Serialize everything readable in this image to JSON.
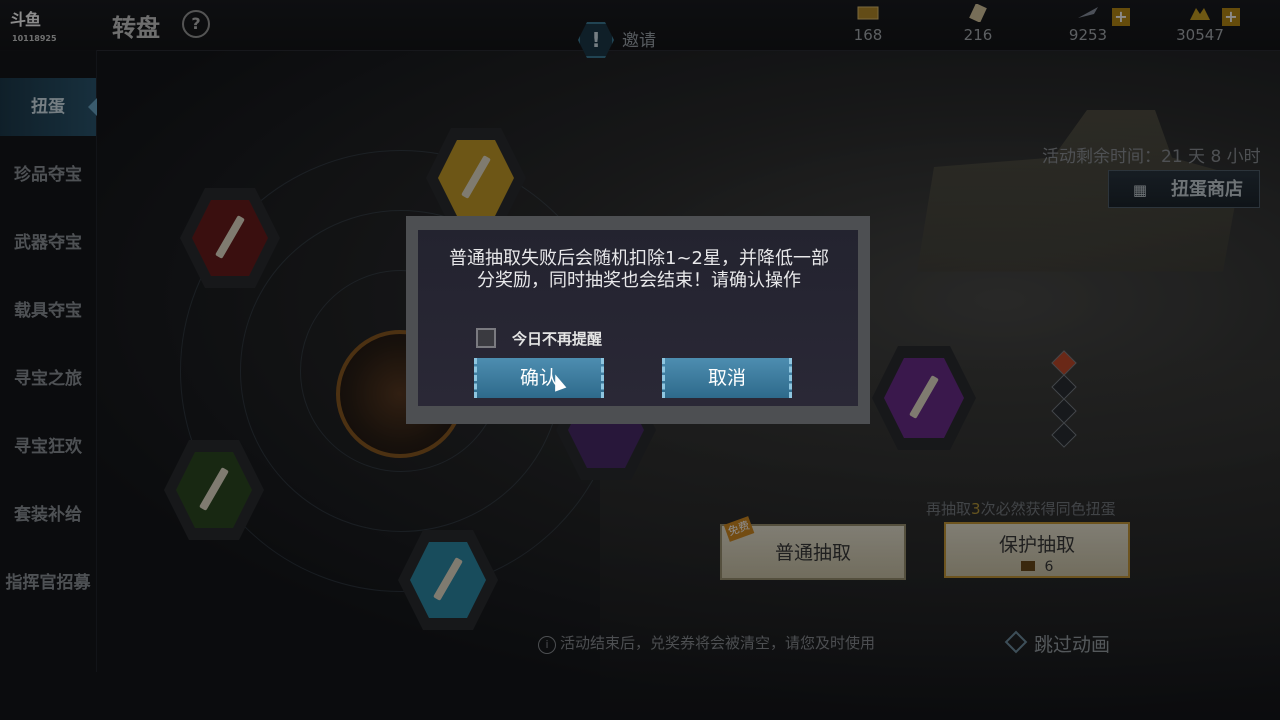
{
  "app": {
    "logo_text": "斗鱼",
    "logo_sub": "10118925",
    "title": "转盘",
    "invite_label": "邀请"
  },
  "resources": [
    {
      "name": "ticket-icon",
      "value": "168"
    },
    {
      "name": "scroll-icon",
      "value": "216"
    },
    {
      "name": "plane-icon",
      "value": "9253"
    },
    {
      "name": "gold-icon",
      "value": "30547"
    }
  ],
  "sidebar": {
    "items": [
      {
        "label": "扭蛋",
        "active": true
      },
      {
        "label": "珍品夺宝"
      },
      {
        "label": "武器夺宝"
      },
      {
        "label": "载具夺宝"
      },
      {
        "label": "寻宝之旅"
      },
      {
        "label": "寻宝狂欢"
      },
      {
        "label": "套装补给"
      },
      {
        "label": "指挥官招募"
      }
    ]
  },
  "event": {
    "remaining": "活动剩余时间：21 天 8 小时",
    "shop_label": "扭蛋商店",
    "guarantee_prefix": "再抽取",
    "guarantee_num": "3",
    "guarantee_suffix": "次必然获得同色扭蛋",
    "normal_draw": "普通抽取",
    "free_tag": "免费",
    "protect_draw": "保护抽取",
    "protect_cost": "6",
    "bottom_note": "活动结束后，兑奖券将会被清空，请您及时使用",
    "skip": "跳过动画"
  },
  "dialog": {
    "message": "普通抽取失败后会随机扣除1~2星，并降低一部分奖励，同时抽奖也会结束！请确认操作",
    "checkbox_label": "今日不再提醒",
    "confirm": "确认",
    "cancel": "取消"
  },
  "colors": {
    "accent": "#2e6a8b",
    "gold": "#b88a15",
    "dialog_border": "#4d4f52"
  }
}
